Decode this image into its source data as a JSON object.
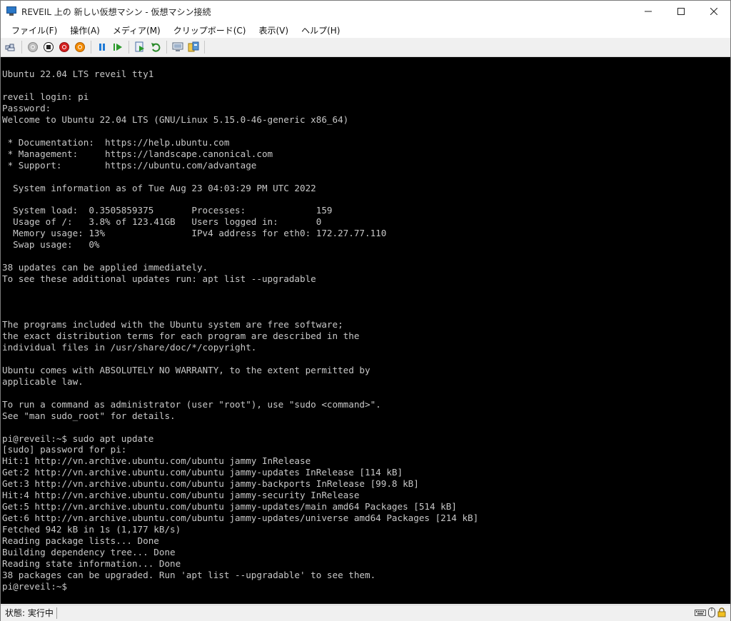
{
  "window": {
    "title": "REVEIL 上の 新しい仮想マシン - 仮想マシン接続"
  },
  "menu": [
    {
      "label": "ファイル(F)"
    },
    {
      "label": "操作(A)"
    },
    {
      "label": "メディア(M)"
    },
    {
      "label": "クリップボード(C)"
    },
    {
      "label": "表示(V)"
    },
    {
      "label": "ヘルプ(H)"
    }
  ],
  "toolbar": [
    {
      "name": "ctrl-alt-del-icon"
    },
    {
      "name": "start-icon"
    },
    {
      "name": "turn-off-icon"
    },
    {
      "name": "shutdown-icon"
    },
    {
      "name": "power-icon"
    },
    {
      "name": "pause-icon"
    },
    {
      "name": "resume-icon"
    },
    {
      "name": "checkpoint-icon"
    },
    {
      "name": "revert-icon"
    },
    {
      "name": "enhanced-session-icon"
    },
    {
      "name": "share-icon"
    }
  ],
  "console": {
    "lines": [
      "Ubuntu 22.04 LTS reveil tty1",
      "",
      "reveil login: pi",
      "Password:",
      "Welcome to Ubuntu 22.04 LTS (GNU/Linux 5.15.0-46-generic x86_64)",
      "",
      " * Documentation:  https://help.ubuntu.com",
      " * Management:     https://landscape.canonical.com",
      " * Support:        https://ubuntu.com/advantage",
      "",
      "  System information as of Tue Aug 23 04:03:29 PM UTC 2022",
      "",
      "  System load:  0.3505859375       Processes:             159",
      "  Usage of /:   3.8% of 123.41GB   Users logged in:       0",
      "  Memory usage: 13%                IPv4 address for eth0: 172.27.77.110",
      "  Swap usage:   0%",
      "",
      "38 updates can be applied immediately.",
      "To see these additional updates run: apt list --upgradable",
      "",
      "",
      "",
      "The programs included with the Ubuntu system are free software;",
      "the exact distribution terms for each program are described in the",
      "individual files in /usr/share/doc/*/copyright.",
      "",
      "Ubuntu comes with ABSOLUTELY NO WARRANTY, to the extent permitted by",
      "applicable law.",
      "",
      "To run a command as administrator (user \"root\"), use \"sudo <command>\".",
      "See \"man sudo_root\" for details.",
      "",
      "pi@reveil:~$ sudo apt update",
      "[sudo] password for pi:",
      "Hit:1 http://vn.archive.ubuntu.com/ubuntu jammy InRelease",
      "Get:2 http://vn.archive.ubuntu.com/ubuntu jammy-updates InRelease [114 kB]",
      "Get:3 http://vn.archive.ubuntu.com/ubuntu jammy-backports InRelease [99.8 kB]",
      "Hit:4 http://vn.archive.ubuntu.com/ubuntu jammy-security InRelease",
      "Get:5 http://vn.archive.ubuntu.com/ubuntu jammy-updates/main amd64 Packages [514 kB]",
      "Get:6 http://vn.archive.ubuntu.com/ubuntu jammy-updates/universe amd64 Packages [214 kB]",
      "Fetched 942 kB in 1s (1,177 kB/s)",
      "Reading package lists... Done",
      "Building dependency tree... Done",
      "Reading state information... Done",
      "38 packages can be upgraded. Run 'apt list --upgradable' to see them.",
      "pi@reveil:~$"
    ]
  },
  "status": {
    "text": "状態: 実行中"
  }
}
